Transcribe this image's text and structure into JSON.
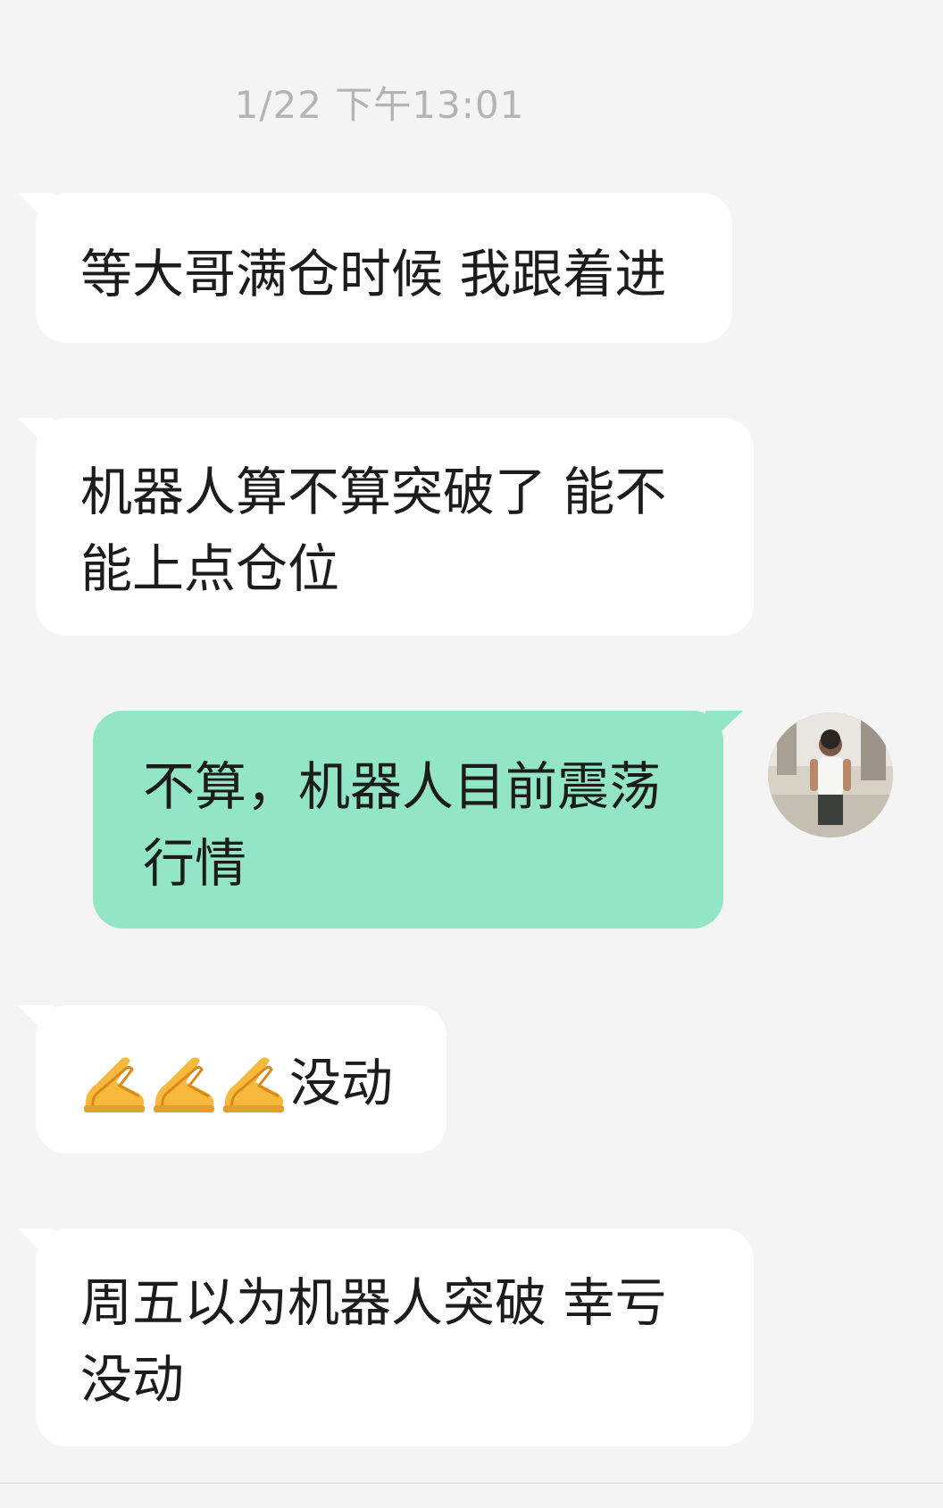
{
  "chat": {
    "timestamp": "1/22 下午13:01",
    "messages": [
      {
        "side": "incoming",
        "text": "等大哥满仓时候 我跟着进"
      },
      {
        "side": "incoming",
        "lines": [
          "机器人算不算突破了  能不",
          "能上点仓位"
        ]
      },
      {
        "side": "outgoing",
        "lines": [
          "不算，机器人目前震荡",
          "行情"
        ]
      },
      {
        "side": "incoming",
        "emoji": [
          "prayer-hands-icon",
          "prayer-hands-icon",
          "prayer-hands-icon"
        ],
        "text": "没动"
      },
      {
        "side": "incoming",
        "lines": [
          "周五以为机器人突破  幸亏",
          "没动"
        ]
      }
    ]
  },
  "colors": {
    "background": "#f3f4f3",
    "incoming_bubble": "#ffffff",
    "outgoing_bubble": "#93e6c5",
    "timestamp_text": "#b4b4b4",
    "message_text": "#1c1c1c"
  }
}
